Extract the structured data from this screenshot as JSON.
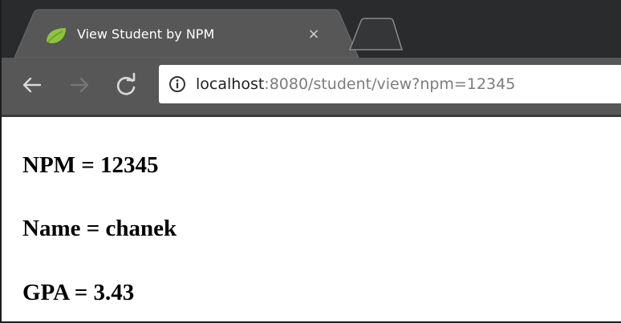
{
  "browser": {
    "tab": {
      "title": "View Student by NPM",
      "close_glyph": "×",
      "favicon": "leaf-icon"
    },
    "toolbar": {
      "back_icon": "arrow-left-icon",
      "forward_icon": "arrow-right-icon",
      "reload_icon": "reload-icon",
      "info_icon": "info-icon"
    },
    "address_bar": {
      "host": "localhost",
      "rest": ":8080/student/view?npm=12345"
    }
  },
  "student": {
    "npm": "NPM = 12345",
    "name": "Name = chanek",
    "gpa": "GPA = 3.43"
  },
  "colors": {
    "tabstrip_bg": "#2a2b2d",
    "active_tab_bg": "#575757",
    "favicon_green": "#8fc43f",
    "url_host": "#202020",
    "url_rest": "#7c7c7c"
  }
}
